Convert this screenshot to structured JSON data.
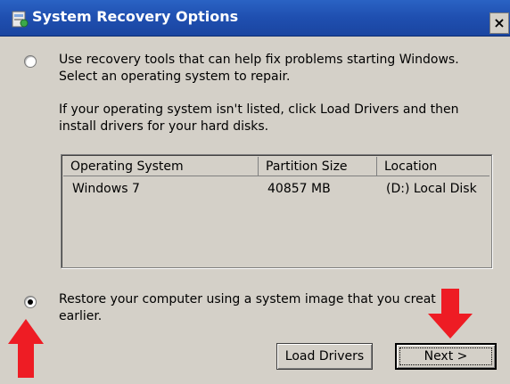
{
  "window": {
    "title": "System Recovery Options",
    "close_glyph": "×",
    "title_icon": "recovery-icon"
  },
  "option_repair": {
    "selected": false,
    "text_line1": "Use recovery tools that can help fix problems starting Windows.",
    "text_line2": "Select an operating system to repair.",
    "note_line1": "If your operating system isn't listed, click Load Drivers and then",
    "note_line2": "install drivers for your hard disks."
  },
  "os_list": {
    "columns": [
      "Operating System",
      "Partition Size",
      "Location"
    ],
    "rows": [
      [
        "Windows 7",
        "40857 MB",
        "(D:) Local Disk"
      ]
    ]
  },
  "option_restore": {
    "selected": true,
    "text_line1": "Restore your computer using a system image that you creat",
    "text_line2": "earlier."
  },
  "buttons": {
    "load_drivers": "Load Drivers",
    "next": "Next >"
  },
  "annotations": {
    "arrow_color": "#ee1c24",
    "arrow_up": "arrow-up-icon",
    "arrow_down": "arrow-down-icon"
  }
}
